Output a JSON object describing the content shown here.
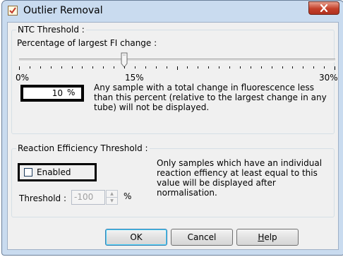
{
  "window": {
    "title": "Outlier Removal",
    "app_icon": "checkbox-app-icon",
    "close_icon": "close-x-icon"
  },
  "ntc_group": {
    "legend": "NTC Threshold :",
    "slider_label": "Percentage of largest FI change :",
    "slider": {
      "min": 0,
      "max": 30,
      "value": 10
    },
    "scale_min": "0%",
    "scale_mid": "15%",
    "scale_max": "30%",
    "percent_value": "10",
    "percent_unit": "%",
    "description": "Any sample with a total change in fluorescence less than this percent (relative to the largest change in any tube) will not be displayed."
  },
  "reaction_group": {
    "legend": "Reaction Efficiency Threshold :",
    "enabled_label": "Enabled",
    "enabled_checked": false,
    "threshold_label": "Threshold :",
    "threshold_value": "-100",
    "threshold_unit": "%",
    "description": "Only samples which have an individual reaction effiency at least equal to this value will be displayed after normalisation."
  },
  "buttons": {
    "ok": "OK",
    "cancel": "Cancel",
    "help_first": "H",
    "help_rest": "elp"
  },
  "colors": {
    "frame": "#c9dbef",
    "client": "#f0f0f0",
    "close_button": "#c4402a"
  }
}
